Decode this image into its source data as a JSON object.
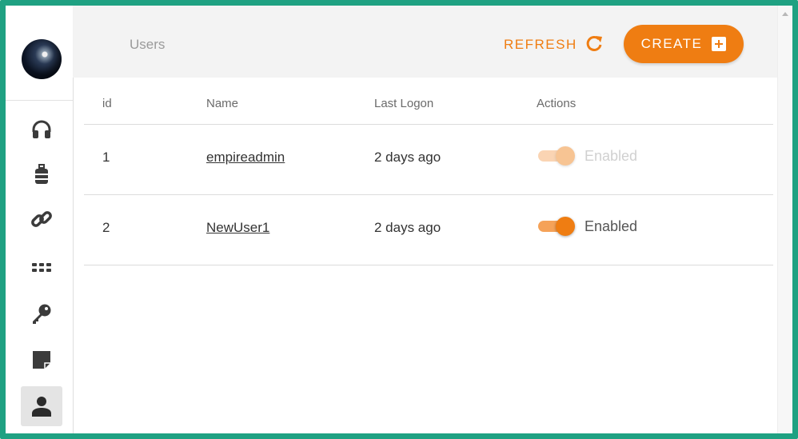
{
  "header": {
    "title": "Users",
    "refresh_label": "REFRESH",
    "create_label": "CREATE"
  },
  "sidebar": {
    "items": [
      {
        "name": "listeners",
        "icon": "headset-icon",
        "active": false
      },
      {
        "name": "stagers",
        "icon": "suitcase-icon",
        "active": false
      },
      {
        "name": "agents",
        "icon": "link-icon",
        "active": false
      },
      {
        "name": "modules",
        "icon": "grid-dots-icon",
        "active": false
      },
      {
        "name": "credentials",
        "icon": "key-icon",
        "active": false
      },
      {
        "name": "reporting",
        "icon": "note-icon",
        "active": false
      },
      {
        "name": "users",
        "icon": "person-icon",
        "active": true
      }
    ]
  },
  "table": {
    "columns": [
      "id",
      "Name",
      "Last Logon",
      "Actions"
    ],
    "rows": [
      {
        "id": "1",
        "name": "empireadmin",
        "last_logon": "2 days ago",
        "status": "Enabled",
        "enabled": true,
        "toggle_disabled": true
      },
      {
        "id": "2",
        "name": "NewUser1",
        "last_logon": "2 days ago",
        "status": "Enabled",
        "enabled": true,
        "toggle_disabled": false
      }
    ]
  },
  "colors": {
    "accent": "#ef7d12",
    "frame": "#1fa182",
    "header_bg": "#f3f3f3",
    "icon": "#3b3b3b"
  }
}
